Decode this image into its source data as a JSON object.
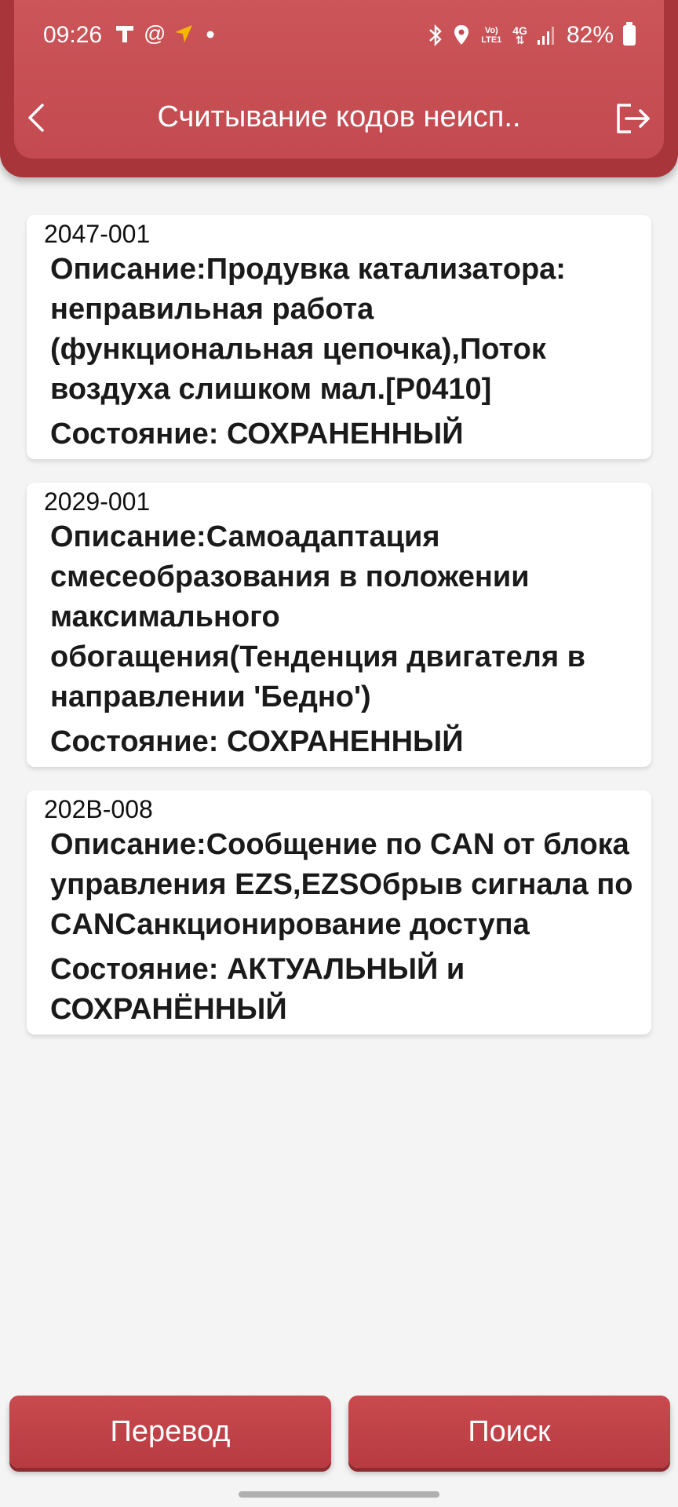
{
  "status_bar": {
    "time": "09:26",
    "battery": "82%",
    "network_label": "4G",
    "volte_label": "Vo) LTE1"
  },
  "header": {
    "title": "Считывание кодов неисп.."
  },
  "faults": [
    {
      "code": "2047-001",
      "description": "Описание:Продувка катализатора: неправильная работа (функциональная цепочка),Поток воздуха слишком мал.[P0410]",
      "state": "Состояние: СОХРАНЕННЫЙ"
    },
    {
      "code": "2029-001",
      "description": "Описание:Самоадаптация смесеобразования в положении максимального обогащения(Тенденция двигателя в направлении 'Бедно')",
      "state": "Состояние: СОХРАНЕННЫЙ"
    },
    {
      "code": "202B-008",
      "description": "Описание:Сообщение по CAN от блока управления EZS,EZSОбрыв сигнала по CANСанкционирование доступа",
      "state": "Состояние: АКТУАЛЬНЫЙ и СОХРАНЁННЫЙ"
    }
  ],
  "buttons": {
    "translate": "Перевод",
    "search": "Поиск"
  },
  "colors": {
    "header": "#c24a50",
    "button": "#c0434a",
    "background": "#f4f4f4"
  }
}
